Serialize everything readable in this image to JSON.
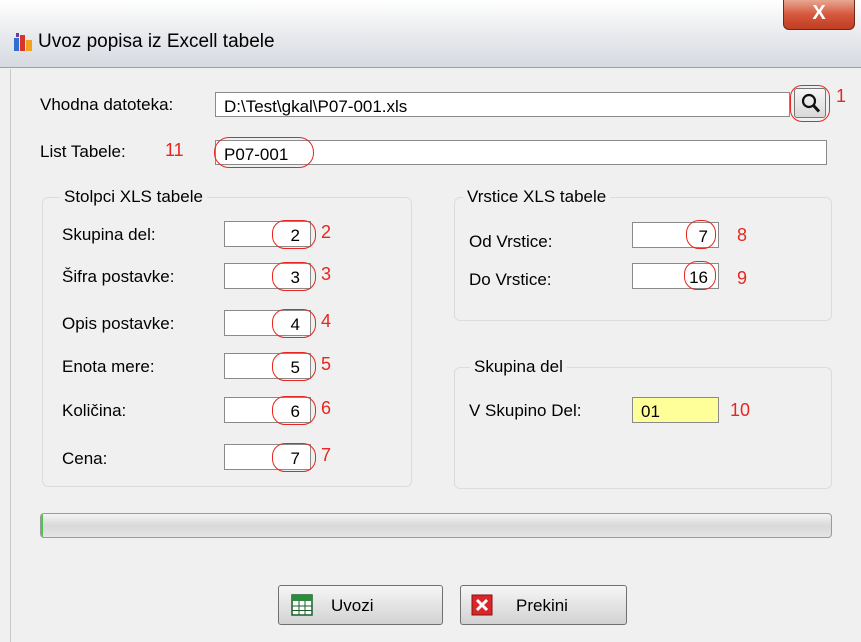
{
  "window": {
    "title": "Uvoz popisa iz Excell tabele",
    "close_glyph": "X"
  },
  "file": {
    "label": "Vhodna datoteka:",
    "value": "D:\\Test\\gkal\\P07-001.xls",
    "annotation": "1"
  },
  "sheet": {
    "label": "List Tabele:",
    "annotation": "11",
    "value": "P07-001"
  },
  "columns_group": {
    "title": "Stolpci XLS tabele",
    "rows": [
      {
        "label": "Skupina del:",
        "value": "2",
        "annotation": "2"
      },
      {
        "label": "Šifra postavke:",
        "value": "3",
        "annotation": "3"
      },
      {
        "label": "Opis postavke:",
        "value": "4",
        "annotation": "4"
      },
      {
        "label": "Enota mere:",
        "value": "5",
        "annotation": "5"
      },
      {
        "label": "Količina:",
        "value": "6",
        "annotation": "6"
      },
      {
        "label": "Cena:",
        "value": "7",
        "annotation": "7"
      }
    ]
  },
  "rows_group": {
    "title": "Vrstice XLS tabele",
    "from_label": "Od Vrstice:",
    "from_value": "7",
    "from_annotation": "8",
    "to_label": "Do Vrstice:",
    "to_value": "16",
    "to_annotation": "9"
  },
  "parts_group": {
    "title": "Skupina del",
    "label": "V Skupino Del:",
    "value": "01",
    "annotation": "10"
  },
  "progress": {
    "fraction": 0.0
  },
  "buttons": {
    "import_label": "Uvozi",
    "cancel_label": "Prekini"
  },
  "colors": {
    "annotation_red": "#e8261f",
    "highlight_input": "#ffff99",
    "progress_fill": "#4ec64e"
  }
}
